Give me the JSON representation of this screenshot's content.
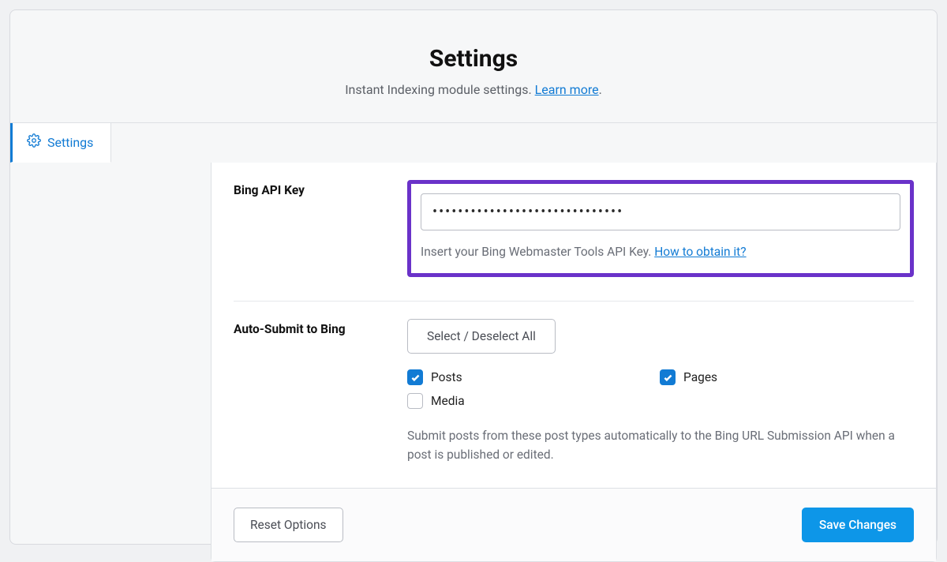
{
  "header": {
    "title": "Settings",
    "subtitle_prefix": "Instant Indexing module settings. ",
    "learn_more": "Learn more",
    "subtitle_suffix": "."
  },
  "tabs": {
    "settings_label": "Settings"
  },
  "api_key": {
    "label": "Bing API Key",
    "value": "••••••••••••••••••••••••••••••",
    "helper_text": "Insert your Bing Webmaster Tools API Key. ",
    "helper_link": "How to obtain it?"
  },
  "auto_submit": {
    "label": "Auto-Submit to Bing",
    "toggle_all": "Select / Deselect All",
    "options": [
      {
        "label": "Posts",
        "checked": true
      },
      {
        "label": "Pages",
        "checked": true
      },
      {
        "label": "Media",
        "checked": false
      }
    ],
    "description": "Submit posts from these post types automatically to the Bing URL Submission API when a post is published or edited."
  },
  "footer": {
    "reset": "Reset Options",
    "save": "Save Changes"
  }
}
